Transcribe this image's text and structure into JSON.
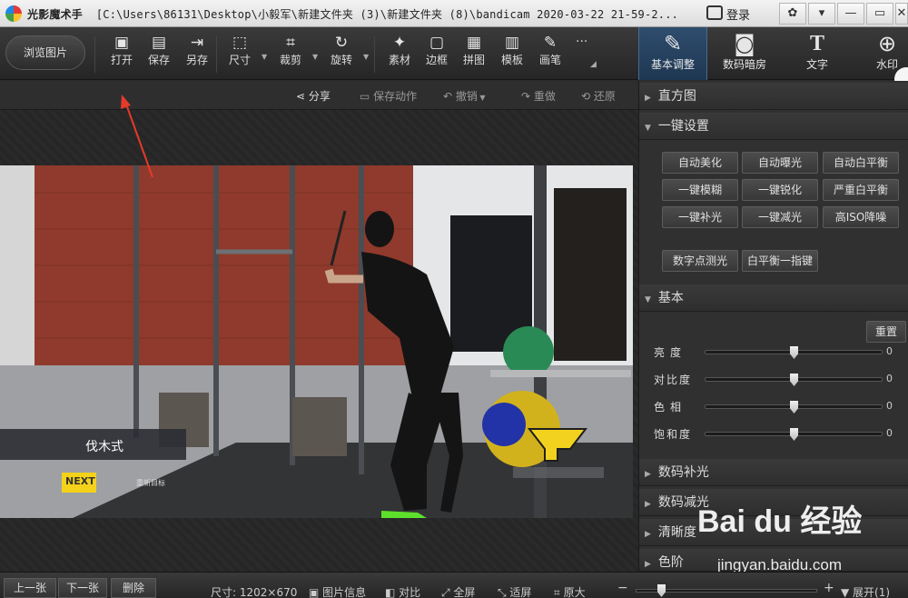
{
  "titlebar": {
    "app_name": "光影魔术手",
    "path": "[C:\\Users\\86131\\Desktop\\小毅军\\新建文件夹 (3)\\新建文件夹 (8)\\bandicam 2020-03-22 21-59-2...",
    "login": "登录",
    "controls": [
      "✿",
      "▾",
      "—",
      "▭",
      "✕"
    ]
  },
  "toolbar": {
    "browse": "浏览图片",
    "tools": [
      {
        "label": "打开",
        "icon": "open-image-icon",
        "glyph": "▣"
      },
      {
        "label": "保存",
        "icon": "save-icon",
        "glyph": "▤"
      },
      {
        "label": "另存",
        "icon": "save-as-icon",
        "glyph": "⇥"
      },
      {
        "label": "尺寸",
        "icon": "resize-icon",
        "glyph": "⬚"
      },
      {
        "label": "裁剪",
        "icon": "crop-icon",
        "glyph": "⌗"
      },
      {
        "label": "旋转",
        "icon": "rotate-icon",
        "glyph": "↻"
      },
      {
        "label": "素材",
        "icon": "material-icon",
        "glyph": "✦"
      },
      {
        "label": "边框",
        "icon": "border-icon",
        "glyph": "▢"
      },
      {
        "label": "拼图",
        "icon": "collage-icon",
        "glyph": "▦"
      },
      {
        "label": "模板",
        "icon": "template-icon",
        "glyph": "▥"
      },
      {
        "label": "画笔",
        "icon": "brush-icon",
        "glyph": "✎"
      }
    ],
    "more": "···",
    "tabs": [
      {
        "label": "基本调整",
        "icon": "basic-adjust-icon",
        "glyph": "✎"
      },
      {
        "label": "数码暗房",
        "icon": "darkroom-icon",
        "glyph": "◙"
      },
      {
        "label": "文字",
        "icon": "text-icon",
        "glyph": "T"
      },
      {
        "label": "水印",
        "icon": "watermark-icon",
        "glyph": "⊕"
      }
    ]
  },
  "actions": {
    "share": "分享",
    "save_action": "保存动作",
    "undo": "撤销",
    "redo": "重做",
    "restore": "还原"
  },
  "photo": {
    "caption": "伐木式",
    "next": "NEXT",
    "sub": "重新目标"
  },
  "panel": {
    "histogram": "直方图",
    "oneclick": "一键设置",
    "oneclick_buttons": [
      "自动美化",
      "自动曝光",
      "自动白平衡",
      "一键模糊",
      "一键锐化",
      "严重白平衡",
      "一键补光",
      "一键减光",
      "高ISO降噪",
      "数字点测光",
      "白平衡一指键"
    ],
    "basic": "基本",
    "reset": "重置",
    "sliders": [
      {
        "label": "亮度",
        "value": "0"
      },
      {
        "label": "对比度",
        "value": "0"
      },
      {
        "label": "色相",
        "value": "0"
      },
      {
        "label": "饱和度",
        "value": "0"
      }
    ],
    "sections": [
      "数码补光",
      "数码减光",
      "清晰度",
      "色阶"
    ]
  },
  "status": {
    "prev": "上一张",
    "next": "下一张",
    "delete": "删除",
    "size": "尺寸: 1202×670",
    "info": "图片信息",
    "compare": "对比",
    "fullscreen": "全屏",
    "fit": "适屏",
    "original": "原大",
    "expand": "展开(1)"
  },
  "watermark": {
    "brand": "Bai du 经验",
    "url": "jingyan.baidu.com"
  }
}
